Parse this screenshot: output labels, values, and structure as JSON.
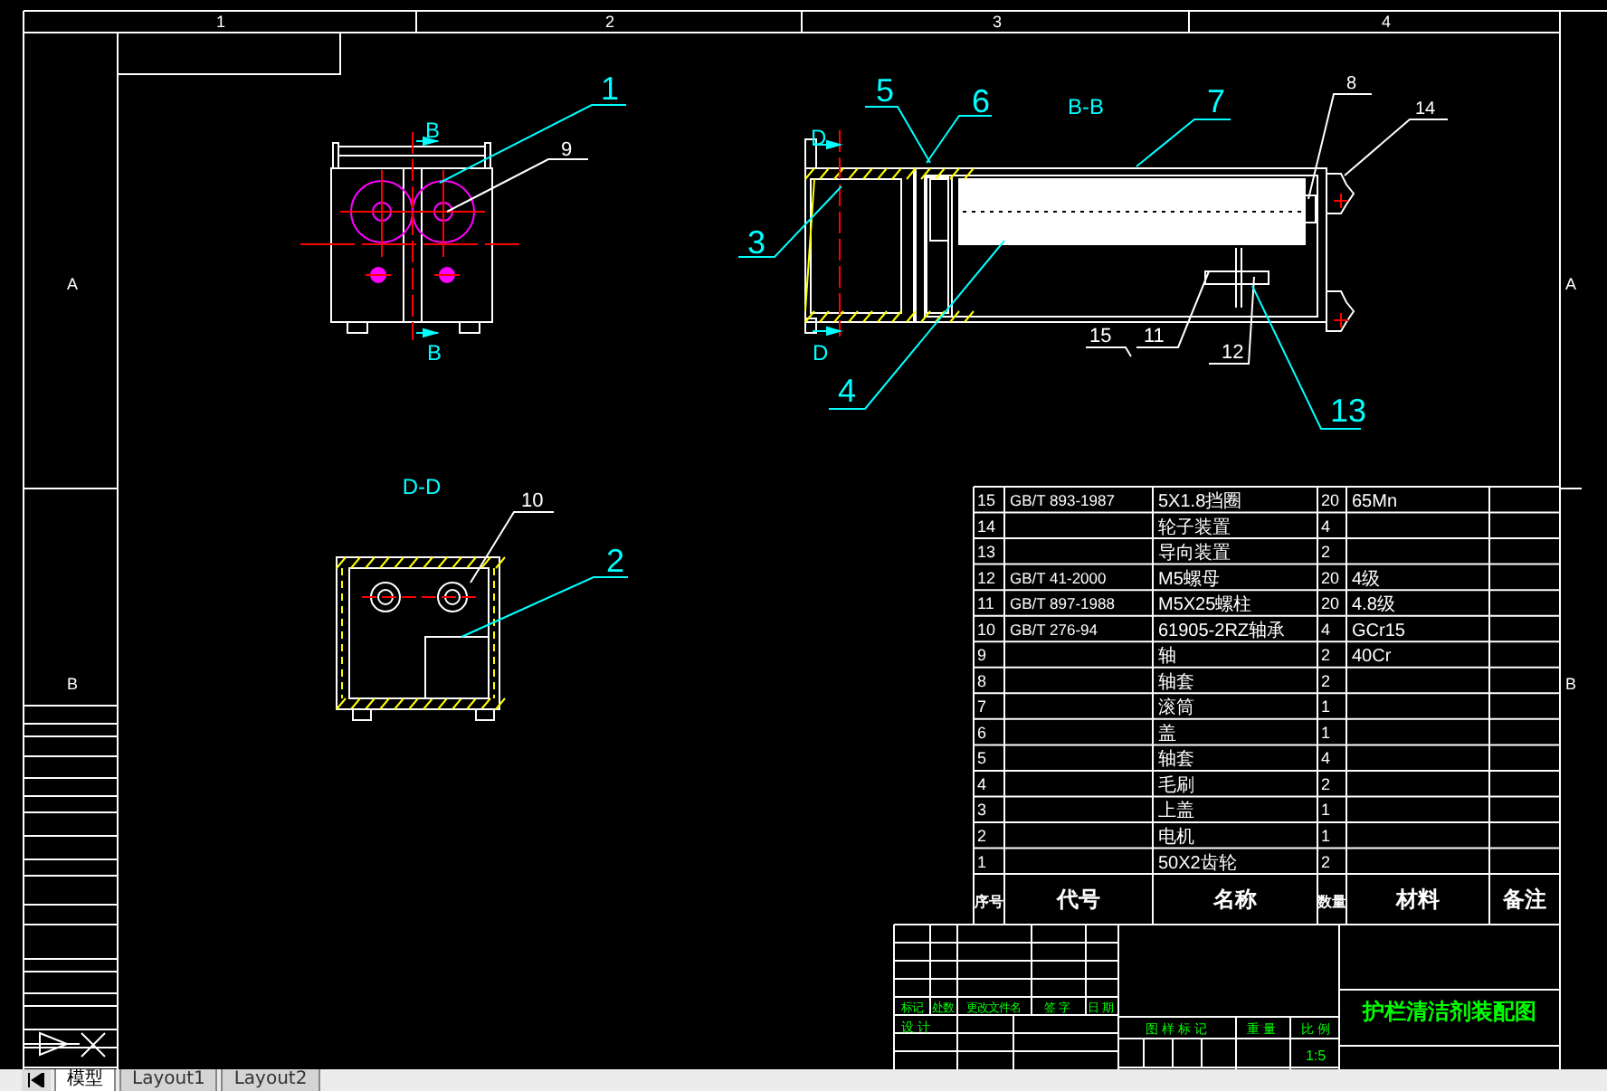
{
  "frame": {
    "zone_numbers": [
      "1",
      "2",
      "3",
      "4"
    ],
    "zone_letters_left": [
      "A",
      "B"
    ],
    "zone_letters_right": [
      "A",
      "B"
    ]
  },
  "section_labels": [
    "B",
    "B",
    "D",
    "D"
  ],
  "view_titles": [
    "B-B",
    "D-D"
  ],
  "callouts": [
    {
      "label": "1",
      "color": "#00ffff"
    },
    {
      "label": "9",
      "color": "#ffffff"
    },
    {
      "label": "5",
      "color": "#00ffff"
    },
    {
      "label": "6",
      "color": "#00ffff"
    },
    {
      "label": "7",
      "color": "#00ffff"
    },
    {
      "label": "8",
      "color": "#ffffff"
    },
    {
      "label": "14",
      "color": "#ffffff"
    },
    {
      "label": "3",
      "color": "#00ffff"
    },
    {
      "label": "4",
      "color": "#00ffff"
    },
    {
      "label": "15",
      "color": "#ffffff"
    },
    {
      "label": "11",
      "color": "#ffffff"
    },
    {
      "label": "12",
      "color": "#ffffff"
    },
    {
      "label": "13",
      "color": "#00ffff"
    },
    {
      "label": "10",
      "color": "#ffffff"
    },
    {
      "label": "2",
      "color": "#00ffff"
    }
  ],
  "parts_list": {
    "rows": [
      {
        "no": "15",
        "code": "GB/T 893-1987",
        "name": "5X1.8挡圈",
        "qty": "20",
        "material": "65Mn"
      },
      {
        "no": "14",
        "name": "轮子装置",
        "qty": "4"
      },
      {
        "no": "13",
        "name": "导向装置",
        "qty": "2"
      },
      {
        "no": "12",
        "code": "GB/T 41-2000",
        "name": "M5螺母",
        "qty": "20",
        "material": "4级"
      },
      {
        "no": "11",
        "code": "GB/T 897-1988",
        "name": "M5X25螺柱",
        "qty": "20",
        "material": "4.8级"
      },
      {
        "no": "10",
        "code": "GB/T 276-94",
        "name": "61905-2RZ轴承",
        "qty": "4",
        "material": "GCr15"
      },
      {
        "no": "9",
        "name": "轴",
        "qty": "2",
        "material": "40Cr"
      },
      {
        "no": "8",
        "name": "轴套",
        "qty": "2"
      },
      {
        "no": "7",
        "name": "滚筒",
        "qty": "1"
      },
      {
        "no": "6",
        "name": "盖",
        "qty": "1"
      },
      {
        "no": "5",
        "name": "轴套",
        "qty": "4"
      },
      {
        "no": "4",
        "name": "毛刷",
        "qty": "2"
      },
      {
        "no": "3",
        "name": "上盖",
        "qty": "1"
      },
      {
        "no": "2",
        "name": "电机",
        "qty": "1"
      },
      {
        "no": "1",
        "name": "50X2齿轮",
        "qty": "2"
      }
    ],
    "header": [
      "序号",
      "代号",
      "名称",
      "数量",
      "材料",
      "备注"
    ]
  },
  "title_block": {
    "title": "护栏清洁剂装配图",
    "revision_labels": [
      "标记",
      "处数",
      "更改文件名",
      "签 字",
      "日 期"
    ],
    "designer_label": "设 计",
    "info_labels": [
      "图 样 标 记",
      "重 量",
      "比 例"
    ],
    "scale": "1:5"
  },
  "layout_tabs": [
    {
      "label": "模型",
      "selected": true
    },
    {
      "label": "Layout1",
      "selected": false
    },
    {
      "label": "Layout2",
      "selected": false
    }
  ]
}
